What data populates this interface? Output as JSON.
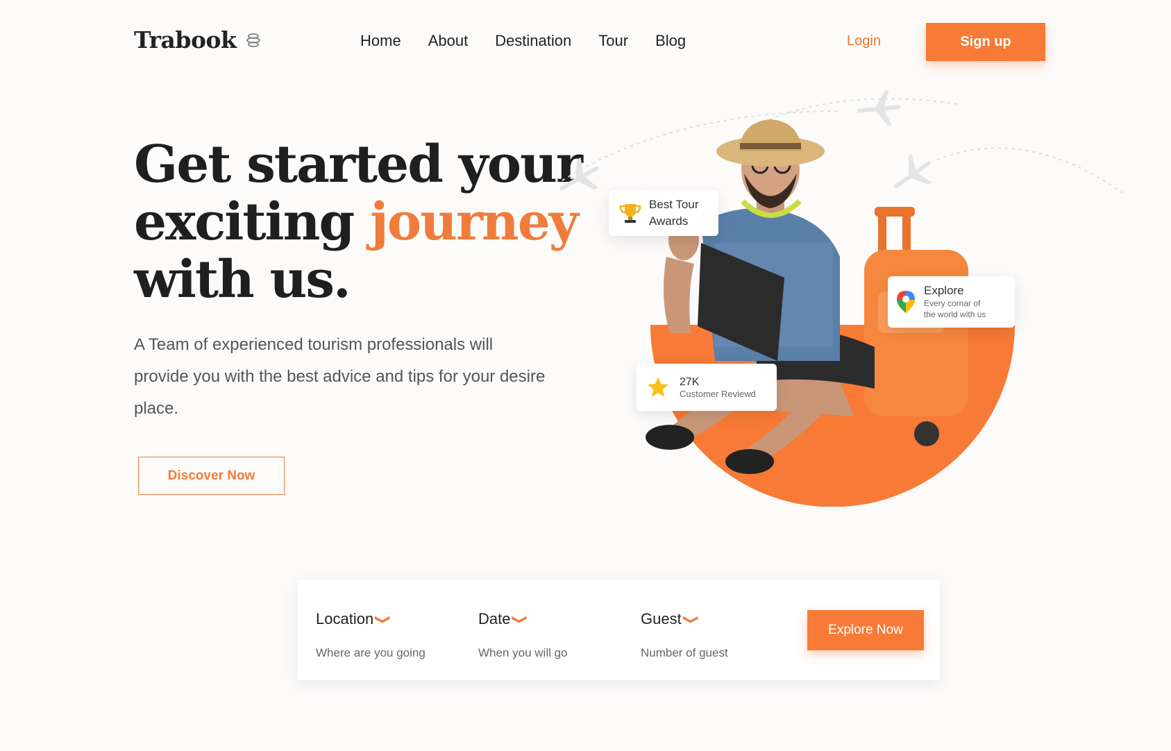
{
  "brand": {
    "name": "Trabook",
    "logo_icon": "globe-stack-icon"
  },
  "nav": {
    "items": [
      "Home",
      "About",
      "Destination",
      "Tour",
      "Blog"
    ]
  },
  "auth": {
    "login": "Login",
    "signup": "Sign up"
  },
  "hero": {
    "headline_line1": "Get started your",
    "headline_line2_a": "exciting",
    "headline_line2_b": "journey",
    "headline_line3": "with us.",
    "description": "A Team of experienced tourism professionals will provide you with the best advice and tips for your desire place.",
    "cta": "Discover Now"
  },
  "badges": {
    "awards": {
      "line1": "Best Tour",
      "line2": "Awards",
      "icon": "trophy-icon"
    },
    "explore": {
      "title": "Explore",
      "line1": "Every cornar of",
      "line2": "the world with us",
      "icon": "map-pin-icon"
    },
    "reviews": {
      "count": "27K",
      "label": "Customer Reviewd",
      "icon": "star-icon"
    }
  },
  "search": {
    "location": {
      "label": "Location",
      "hint": "Where are you going"
    },
    "date": {
      "label": "Date",
      "hint": "When you will go"
    },
    "guest": {
      "label": "Guest",
      "hint": "Number of guest"
    },
    "button": "Explore Now"
  },
  "colors": {
    "accent": "#f77a36",
    "text": "#222222",
    "background": "#fcfbfa"
  }
}
